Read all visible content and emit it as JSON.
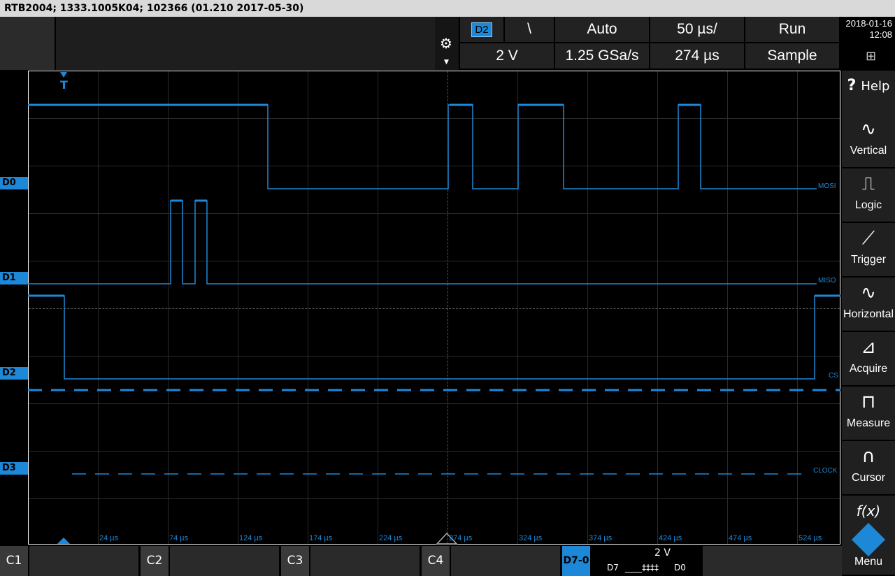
{
  "window_title": "RTB2004; 1333.1005K04; 102366 (01.210 2017-05-30)",
  "toolbar": {
    "channel_chip": "D2",
    "edge_symbol": "\\",
    "trigger_mode": "Auto",
    "time_scale": "50 µs/",
    "run_state": "Run",
    "vertical_scale": "2 V",
    "sample_rate": "1.25 GSa/s",
    "record_length": "274 µs",
    "acq_mode": "Sample"
  },
  "datetime": {
    "date": "2018-01-16",
    "time": "12:08"
  },
  "channels": [
    {
      "label": "D0",
      "signal": "MOSI"
    },
    {
      "label": "D1",
      "signal": "MISO"
    },
    {
      "label": "D2",
      "signal": "CS"
    },
    {
      "label": "D3",
      "signal": "CLOCK"
    }
  ],
  "trigger_marker": "T",
  "time_labels": [
    "24 µs",
    "74 µs",
    "124 µs",
    "174 µs",
    "224 µs",
    "274 µs",
    "324 µs",
    "374 µs",
    "424 µs",
    "474 µs",
    "524 µs"
  ],
  "sidebar": [
    {
      "label": "Help",
      "icon": "help-icon",
      "glyph": "?"
    },
    {
      "label": "Vertical",
      "icon": "vertical-icon",
      "glyph": "∿"
    },
    {
      "label": "Logic",
      "icon": "logic-icon",
      "glyph": "⎍"
    },
    {
      "label": "Trigger",
      "icon": "trigger-icon",
      "glyph": "⟋"
    },
    {
      "label": "Horizontal",
      "icon": "horizontal-icon",
      "glyph": "∿"
    },
    {
      "label": "Acquire",
      "icon": "acquire-icon",
      "glyph": "⊿"
    },
    {
      "label": "Measure",
      "icon": "measure-icon",
      "glyph": "⊓"
    },
    {
      "label": "Cursor",
      "icon": "cursor-icon",
      "glyph": "∩"
    },
    {
      "label": "Menu",
      "icon": "menu-icon",
      "glyph": "f(x)"
    }
  ],
  "bottom_channels": [
    "C1",
    "C2",
    "C3",
    "C4"
  ],
  "logic_group": {
    "tag": "D7-0",
    "scale": "2 V",
    "range_from": "D7",
    "pattern": "____‡‡‡‡",
    "range_to": "D0"
  },
  "colors": {
    "trace": "#1e88d8",
    "grid": "#2a2a2a",
    "background": "#000000"
  }
}
